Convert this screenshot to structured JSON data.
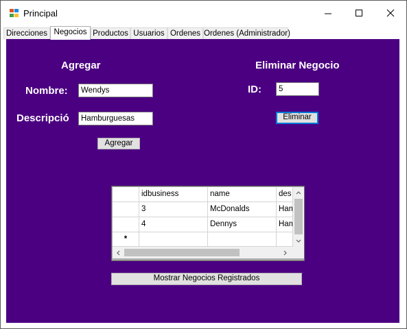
{
  "window": {
    "title": "Principal"
  },
  "tabs": [
    {
      "label": "Direcciones",
      "active": false
    },
    {
      "label": "Negocios",
      "active": true
    },
    {
      "label": "Productos",
      "active": false
    },
    {
      "label": "Usuarios",
      "active": false
    },
    {
      "label": "Ordenes",
      "active": false
    },
    {
      "label": "Ordenes (Administrador)",
      "active": false
    }
  ],
  "colors": {
    "panel": "#4b0082",
    "focus": "#0078d7"
  },
  "add": {
    "title": "Agregar",
    "name_label": "Nombre:",
    "name_value": "Wendys",
    "desc_label": "Descripció",
    "desc_value": "Hamburguesas",
    "button": "Agregar"
  },
  "delete": {
    "title": "Eliminar Negocio",
    "id_label": "ID:",
    "id_value": "5",
    "button": "Eliminar"
  },
  "grid": {
    "columns": [
      "idbusiness",
      "name",
      "des"
    ],
    "rows": [
      [
        "3",
        "McDonalds",
        "Ham"
      ],
      [
        "4",
        "Dennys",
        "Ham"
      ]
    ],
    "new_row_marker": "*"
  },
  "show_button": "Mostrar Negocios Registrados"
}
